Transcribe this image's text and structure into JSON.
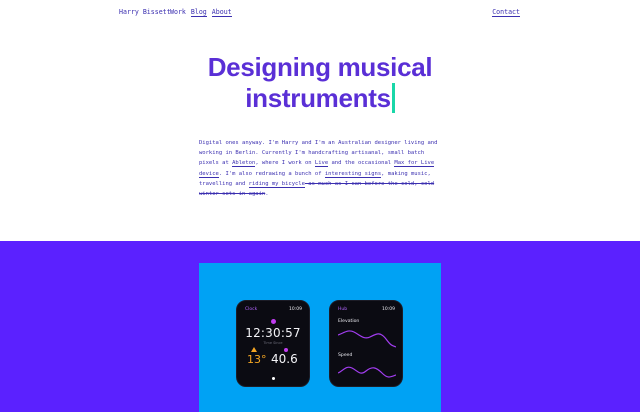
{
  "nav": {
    "brand": "Harry Bissett",
    "links": [
      "Work",
      "Blog",
      "About"
    ],
    "contact": "Contact"
  },
  "hero": {
    "line1": "Designing musical",
    "line2": "instruments"
  },
  "intro": {
    "s1": "Digital ones anyway. I'm Harry and I'm an Australian designer living and working in Berlin. Currently I'm handcrafting artisanal, small batch pixels at ",
    "ableton": "Ableton",
    "s2": ", where I work on ",
    "live": "Live",
    "s3": " and the occasional ",
    "maxlive": "Max for Live device",
    "s4": ". I'm also redrawing a bunch of ",
    "signs": "interesting signs",
    "s5": ", making music, travelling and ",
    "riding": "riding my bicycle",
    "strike": " as much as I can before the cold, cold winter sets in again",
    "end": "."
  },
  "watch1": {
    "label": "Clock",
    "time_small": "10:09",
    "clock": "12:30:57",
    "clock_sub": "Time Since",
    "temp": "13°",
    "value": "40.6"
  },
  "watch2": {
    "label": "Hub",
    "time_small": "10:09",
    "elevation": "Elevation",
    "speed": "Speed"
  },
  "colors": {
    "accent": "#5a2fd6",
    "cursor": "#19d7a8",
    "band": "#5b21ff",
    "panel": "#00a2f4"
  }
}
